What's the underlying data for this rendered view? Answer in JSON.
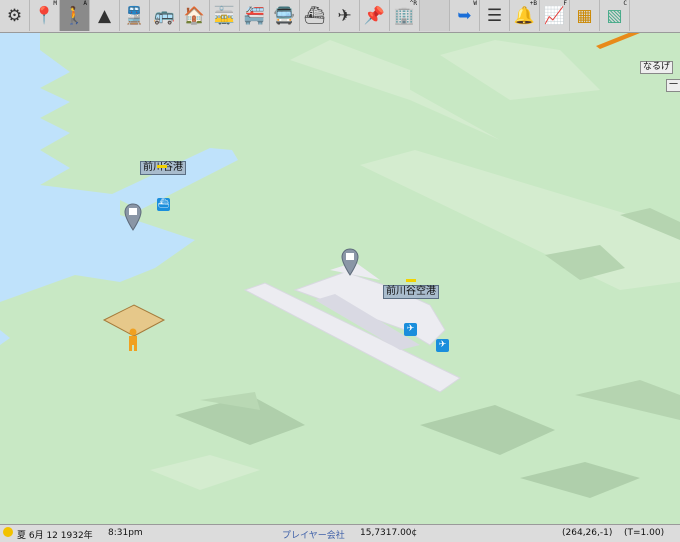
{
  "toolbar": {
    "items": [
      {
        "name": "settings-gear-icon",
        "key": ""
      },
      {
        "name": "map-pin-icon",
        "key": "M"
      },
      {
        "name": "pedestrian-icon",
        "key": "A",
        "selected": true
      },
      {
        "name": "terrain-icon",
        "key": ""
      },
      {
        "name": "train-icon",
        "key": ""
      },
      {
        "name": "bus-icon",
        "key": ""
      },
      {
        "name": "depot-icon",
        "key": ""
      },
      {
        "name": "tram-icon",
        "key": ""
      },
      {
        "name": "monorail-icon",
        "key": ""
      },
      {
        "name": "coach-icon",
        "key": ""
      },
      {
        "name": "ship-icon",
        "key": ""
      },
      {
        "name": "airplane-icon",
        "key": ""
      },
      {
        "name": "balloon-pin-icon",
        "key": ""
      },
      {
        "name": "building-icon",
        "key": "^R"
      },
      {
        "name": "direction-sign-icon",
        "key": "W"
      },
      {
        "name": "list-icon",
        "key": ""
      },
      {
        "name": "bell-icon",
        "key": "+B"
      },
      {
        "name": "line-graph-icon",
        "key": "F"
      },
      {
        "name": "minimap-icon",
        "key": ""
      },
      {
        "name": "chart-window-icon",
        "key": "C"
      }
    ]
  },
  "map": {
    "labels": {
      "port": "前川谷港",
      "airport": "前川谷空港",
      "corner": "なるげ",
      "corner2": "一"
    }
  },
  "status": {
    "season_icon": "sun-icon",
    "date": "夏 6月 12 1932年",
    "time": "8:31pm",
    "company": "プレイヤー会社",
    "money": "15,7317.00¢",
    "coords": "(264,26,-1)",
    "speed": "(T=1.00)"
  },
  "colors": {
    "land": "#c8e8c4",
    "water": "#bfe2fb",
    "runway": "#ececf1",
    "label_bg": "#a9bccd"
  }
}
